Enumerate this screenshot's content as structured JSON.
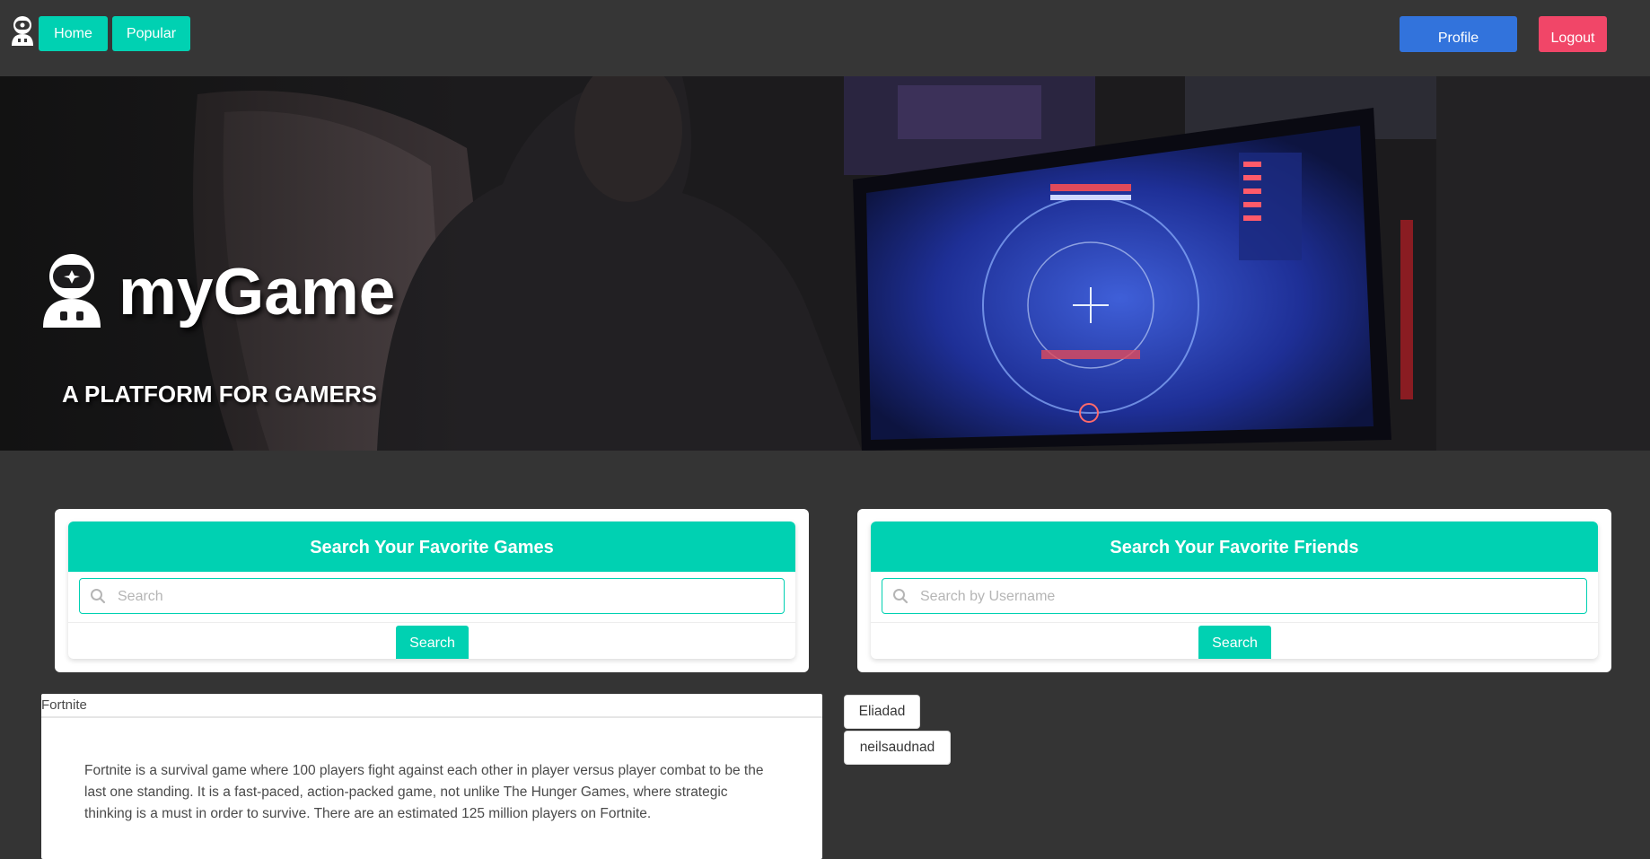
{
  "nav": {
    "home_label": "Home",
    "popular_label": "Popular",
    "profile_label": "Profile",
    "logout_label": "Logout",
    "colors": {
      "primary": "#00d1b2",
      "profile": "#3273dc",
      "logout": "#f14668"
    }
  },
  "hero": {
    "title": "myGame",
    "subtitle": "A PLATFORM FOR GAMERS",
    "logo_icon": "astronaut-icon",
    "background": "gamer-at-monitor-photo"
  },
  "games_search": {
    "heading": "Search Your Favorite Games",
    "placeholder": "Search",
    "value": "",
    "button_label": "Search",
    "icon": "search-icon"
  },
  "friends_search": {
    "heading": "Search Your Favorite Friends",
    "placeholder": "Search by Username",
    "value": "",
    "button_label": "Search",
    "icon": "search-icon"
  },
  "game_result": {
    "title": "Fortnite",
    "description": "Fortnite is a survival game where 100 players fight against each other in player versus player combat to be the last one standing. It is a fast-paced, action-packed game, not unlike The Hunger Games, where strategic thinking is a must in order to survive. There are an estimated 125 million players on Fortnite."
  },
  "friend_results": [
    {
      "username": "Eliadad"
    },
    {
      "username": "neilsaudnad"
    }
  ]
}
